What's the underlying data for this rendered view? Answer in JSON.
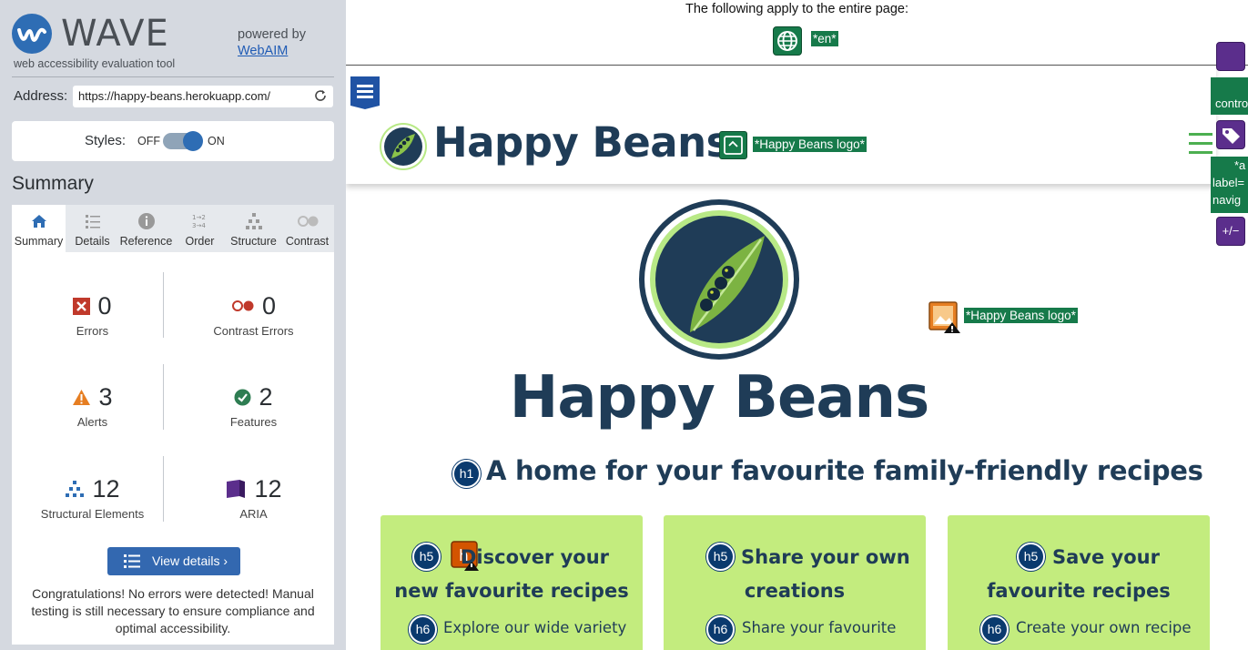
{
  "sidebar": {
    "app_title": "WAVE",
    "app_subtitle": "web accessibility evaluation tool",
    "powered_by": "powered by",
    "webaim_link": "WebAIM",
    "address_label": "Address:",
    "address_value": "https://happy-beans.herokuapp.com/",
    "styles_label": "Styles:",
    "styles_off": "OFF",
    "styles_on": "ON",
    "summary_heading": "Summary",
    "tabs": [
      {
        "label": "Summary",
        "icon": "home-icon"
      },
      {
        "label": "Details",
        "icon": "list-icon"
      },
      {
        "label": "Reference",
        "icon": "info-icon"
      },
      {
        "label": "Order",
        "icon": "order-icon"
      },
      {
        "label": "Structure",
        "icon": "structure-icon"
      },
      {
        "label": "Contrast",
        "icon": "contrast-icon"
      }
    ],
    "stats": {
      "errors": {
        "count": "0",
        "label": "Errors"
      },
      "contrast_errors": {
        "count": "0",
        "label": "Contrast Errors"
      },
      "alerts": {
        "count": "3",
        "label": "Alerts"
      },
      "features": {
        "count": "2",
        "label": "Features"
      },
      "structural": {
        "count": "12",
        "label": "Structural Elements"
      },
      "aria": {
        "count": "12",
        "label": "ARIA"
      }
    },
    "view_details": "View details ›",
    "congrats": "Congratulations! No errors were detected! Manual testing is still necessary to ensure compliance and optimal accessibility."
  },
  "main": {
    "page_notice": "The following apply to the entire page:",
    "lang_tag": "*en*",
    "header": {
      "site_title": "Happy Beans",
      "logo_alt_tag": "*Happy Beans logo*"
    },
    "aria": {
      "control_tag": "control",
      "aria_label_tag": [
        "*a",
        "label=",
        "navig"
      ],
      "expand_icon": "+/−"
    },
    "hero": {
      "logo_alt_tag": "*Happy Beans logo*",
      "title": "Happy Beans"
    },
    "h1_icon": "h1",
    "h1": "A home for your favourite family-friendly recipes",
    "h5_icon": "h5",
    "h6_icon": "h6",
    "h_warn_icon": "h",
    "cards": [
      {
        "h5": "Discover your new favourite recipes",
        "h5_line1": "Discover your",
        "h5_line2": "new favourite recipes",
        "h6": "Explore our wide variety"
      },
      {
        "h5": "Share your own creations",
        "h5_line1": "Share your own",
        "h5_line2": "creations",
        "h6": "Share your favourite"
      },
      {
        "h5": "Save your favourite recipes",
        "h5_line1": "Save your",
        "h5_line2": "favourite recipes",
        "h6": "Create your own recipe"
      }
    ]
  },
  "colors": {
    "wave_blue": "#2e6db4",
    "wave_green": "#167a4a",
    "aria_purple": "#5b2e8c",
    "card_green": "#c3ec7e",
    "brand_navy": "#1f3c57",
    "error_red": "#c0392b",
    "alert_orange": "#e67e22"
  }
}
